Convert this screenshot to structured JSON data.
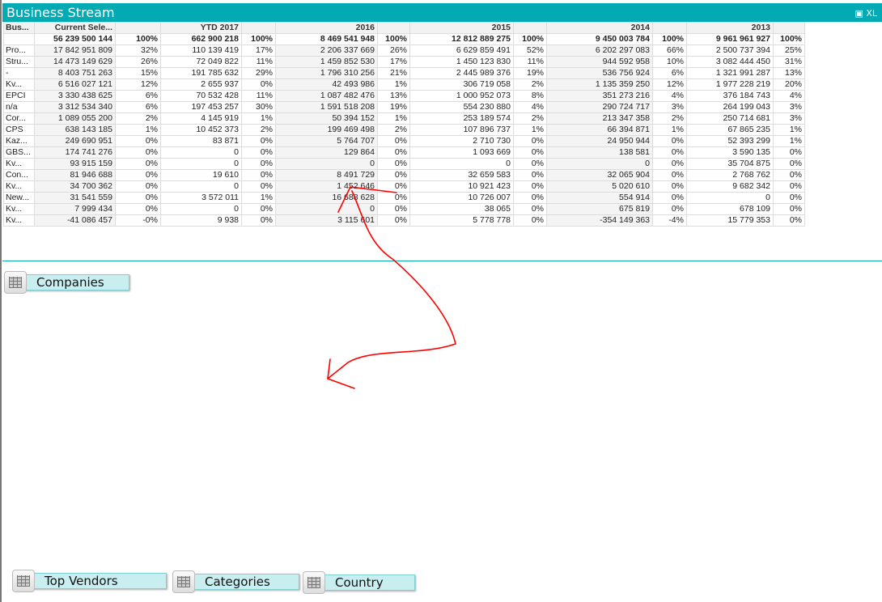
{
  "title": "Business Stream",
  "export_label": "XL",
  "table": {
    "headers": [
      "Bus...",
      "Current Sele...",
      "",
      "YTD 2017",
      "",
      "2016",
      "",
      "2015",
      "",
      "2014",
      "",
      "2013",
      ""
    ],
    "totals": [
      "",
      "56 239 500 144",
      "100%",
      "662 900 218",
      "100%",
      "8 469 541 948",
      "100%",
      "12 812 889 275",
      "100%",
      "9 450 003 784",
      "100%",
      "9 961 961 927",
      "100%"
    ],
    "rows": [
      [
        "Pro...",
        "17 842 951 809",
        "32%",
        "110 139 419",
        "17%",
        "2 206 337 669",
        "26%",
        "6 629 859 491",
        "52%",
        "6 202 297 083",
        "66%",
        "2 500 737 394",
        "25%"
      ],
      [
        "Stru...",
        "14 473 149 629",
        "26%",
        "72 049 822",
        "11%",
        "1 459 852 530",
        "17%",
        "1 450 123 830",
        "11%",
        "944 592 958",
        "10%",
        "3 082 444 450",
        "31%"
      ],
      [
        "-",
        "8 403 751 263",
        "15%",
        "191 785 632",
        "29%",
        "1 796 310 256",
        "21%",
        "2 445 989 376",
        "19%",
        "536 756 924",
        "6%",
        "1 321 991 287",
        "13%"
      ],
      [
        "Kv...",
        "6 516 027 121",
        "12%",
        "2 655 937",
        "0%",
        "42 493 986",
        "1%",
        "306 719 058",
        "2%",
        "1 135 359 250",
        "12%",
        "1 977 228 219",
        "20%"
      ],
      [
        "EPCI",
        "3 330 438 625",
        "6%",
        "70 532 428",
        "11%",
        "1 087 482 476",
        "13%",
        "1 000 952 073",
        "8%",
        "351 273 216",
        "4%",
        "376 184 743",
        "4%"
      ],
      [
        "n/a",
        "3 312 534 340",
        "6%",
        "197 453 257",
        "30%",
        "1 591 518 208",
        "19%",
        "554 230 880",
        "4%",
        "290 724 717",
        "3%",
        "264 199 043",
        "3%"
      ],
      [
        "Cor...",
        "1 089 055 200",
        "2%",
        "4 145 919",
        "1%",
        "50 394 152",
        "1%",
        "253 189 574",
        "2%",
        "213 347 358",
        "2%",
        "250 714 681",
        "3%"
      ],
      [
        "CPS",
        "638 143 185",
        "1%",
        "10 452 373",
        "2%",
        "199 469 498",
        "2%",
        "107 896 737",
        "1%",
        "66 394 871",
        "1%",
        "67 865 235",
        "1%"
      ],
      [
        "Kaz...",
        "249 690 951",
        "0%",
        "83 871",
        "0%",
        "5 764 707",
        "0%",
        "2 710 730",
        "0%",
        "24 950 944",
        "0%",
        "52 393 299",
        "1%"
      ],
      [
        "GBS...",
        "174 741 276",
        "0%",
        "0",
        "0%",
        "129 864",
        "0%",
        "1 093 669",
        "0%",
        "138 581",
        "0%",
        "3 590 135",
        "0%"
      ],
      [
        "Kv...",
        "93 915 159",
        "0%",
        "0",
        "0%",
        "0",
        "0%",
        "0",
        "0%",
        "0",
        "0%",
        "35 704 875",
        "0%"
      ],
      [
        "Con...",
        "81 946 688",
        "0%",
        "19 610",
        "0%",
        "8 491 729",
        "0%",
        "32 659 583",
        "0%",
        "32 065 904",
        "0%",
        "2 768 762",
        "0%"
      ],
      [
        "Kv...",
        "34 700 362",
        "0%",
        "0",
        "0%",
        "1 452 646",
        "0%",
        "10 921 423",
        "0%",
        "5 020 610",
        "0%",
        "9 682 342",
        "0%"
      ],
      [
        "New...",
        "31 541 559",
        "0%",
        "3 572 011",
        "1%",
        "16 688 628",
        "0%",
        "10 726 007",
        "0%",
        "554 914",
        "0%",
        "0",
        "0%"
      ],
      [
        "Kv...",
        "7 999 434",
        "0%",
        "0",
        "0%",
        "0",
        "0%",
        "38 065",
        "0%",
        "675 819",
        "0%",
        "678 109",
        "0%"
      ],
      [
        "Kv...",
        "-41 086 457",
        "-0%",
        "9 938",
        "0%",
        "3 115 601",
        "0%",
        "5 778 778",
        "0%",
        "-354 149 363",
        "-4%",
        "15 779 353",
        "0%"
      ]
    ]
  },
  "buttons": {
    "companies": "Companies",
    "top_vendors": "Top Vendors",
    "categories": "Categories",
    "country": "Country"
  },
  "colors": {
    "accent": "#02aab4",
    "annotation": "#ff0000"
  }
}
